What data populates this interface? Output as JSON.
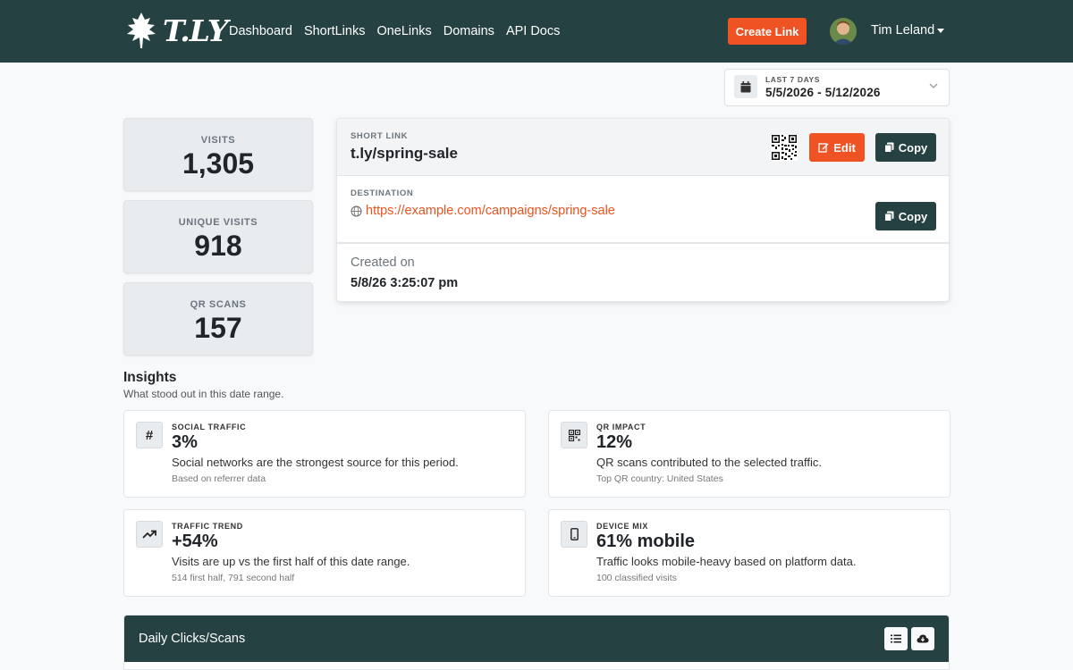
{
  "nav": {
    "brand": "T.LY",
    "links": [
      "Dashboard",
      "ShortLinks",
      "OneLinks",
      "Domains",
      "API Docs"
    ],
    "create_button": "Create Link",
    "user_name": "Tim Leland"
  },
  "date_filter": {
    "label": "LAST 7 DAYS",
    "range": "5/5/2026 - 5/12/2026"
  },
  "stats": [
    {
      "label": "VISITS",
      "value": "1,305"
    },
    {
      "label": "UNIQUE VISITS",
      "value": "918"
    },
    {
      "label": "QR SCANS",
      "value": "157"
    }
  ],
  "link": {
    "short_label": "SHORT LINK",
    "short_url": "t.ly/spring-sale",
    "edit_button": "Edit",
    "copy_button": "Copy",
    "destination_label": "DESTINATION",
    "destination_url": "https://example.com/campaigns/spring-sale",
    "created_label": "Created on",
    "created_value": "5/8/26 3:25:07 pm"
  },
  "insights": {
    "title": "Insights",
    "subtitle": "What stood out in this date range.",
    "cards": [
      {
        "icon": "hashtag-icon",
        "label": "SOCIAL TRAFFIC",
        "value": "3%",
        "description": "Social networks are the strongest source for this period.",
        "sub": "Based on referrer data"
      },
      {
        "icon": "qr-code-icon",
        "label": "QR IMPACT",
        "value": "12%",
        "description": "QR scans contributed to the selected traffic.",
        "sub": "Top QR country: United States"
      },
      {
        "icon": "trend-up-icon",
        "label": "TRAFFIC TREND",
        "value": "+54%",
        "description": "Visits are up vs the first half of this date range.",
        "sub": "514 first half, 791 second half"
      },
      {
        "icon": "mobile-icon",
        "label": "DEVICE MIX",
        "value": "61% mobile",
        "description": "Traffic looks mobile-heavy based on platform data.",
        "sub": "100 classified visits"
      }
    ]
  },
  "daily": {
    "title": "Daily Clicks/Scans"
  },
  "colors": {
    "nav_bg": "#264141",
    "accent": "#f05323",
    "page_bg": "#f8f9fa"
  }
}
